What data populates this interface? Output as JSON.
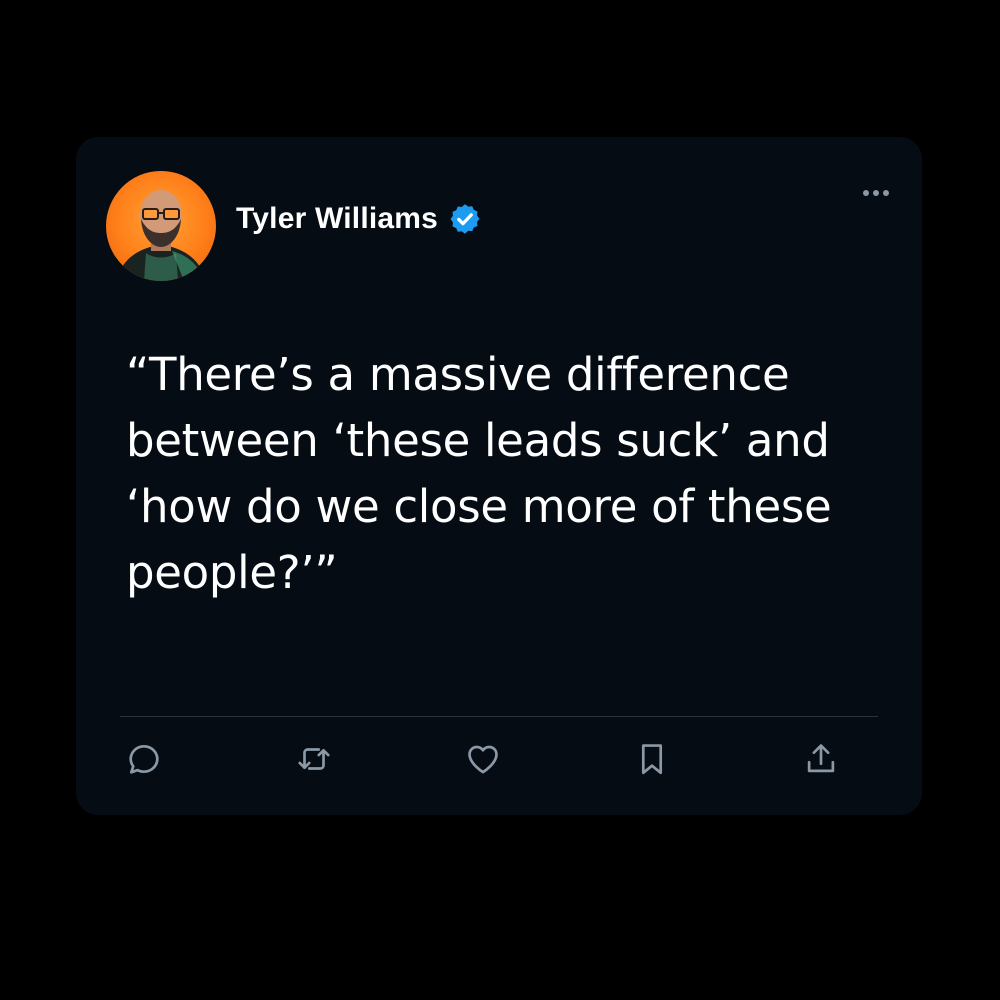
{
  "post": {
    "author": {
      "name": "Tyler Williams",
      "verified": true
    },
    "text": "“There’s a massive difference between ‘these leads suck’ and ‘how do we close more of these people?’”"
  },
  "icons": {
    "more": "more-horizontal-icon",
    "verified": "verified-badge-icon",
    "reply": "reply-icon",
    "retweet": "retweet-icon",
    "like": "heart-icon",
    "bookmark": "bookmark-icon",
    "share": "share-icon"
  },
  "colors": {
    "page_background": "#000000",
    "card_background": "#050c14",
    "text_primary": "#ffffff",
    "icon_muted": "#8b98a5",
    "verified_blue": "#1d9bf0",
    "avatar_orange": "#ff7f1a"
  }
}
